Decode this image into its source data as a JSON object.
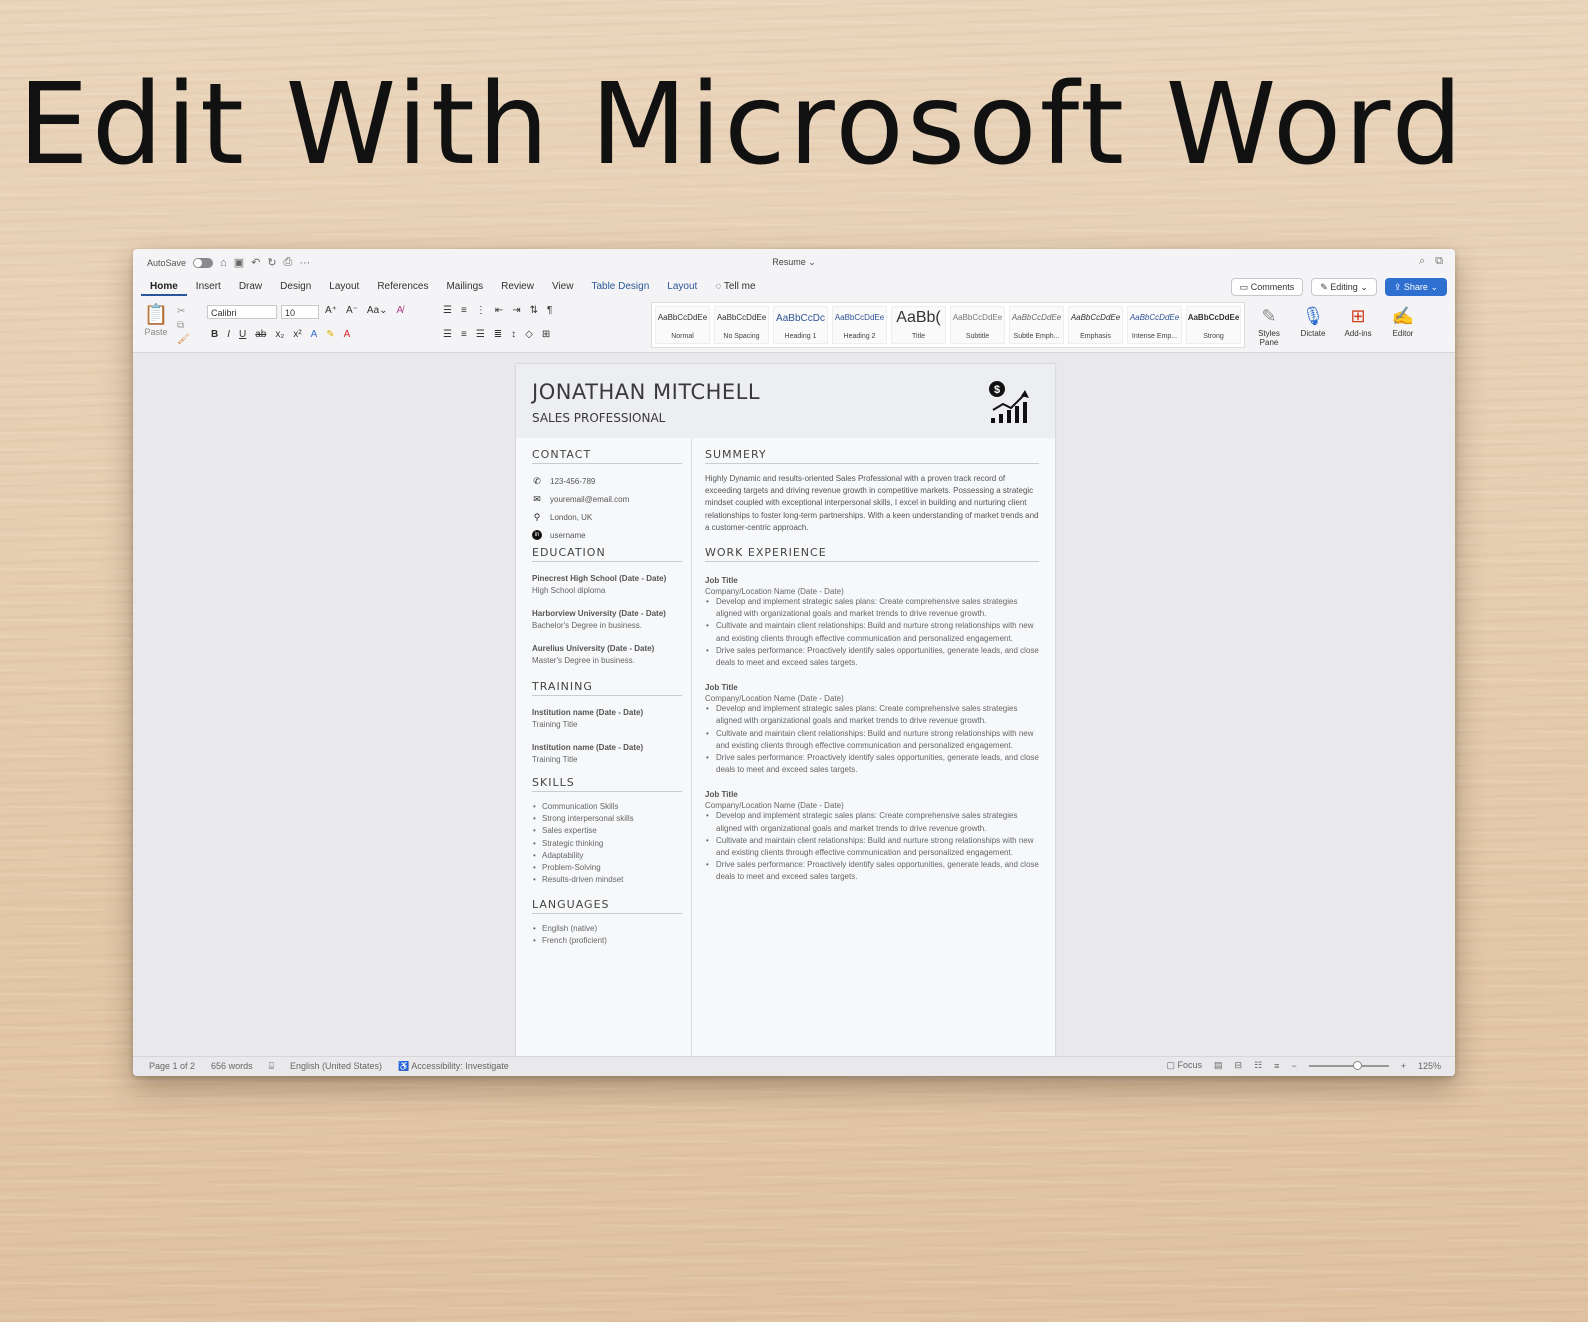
{
  "hero_title": "Edit With Microsoft Word",
  "titlebar": {
    "autosave": "AutoSave",
    "doc_title": "Resume"
  },
  "tabs": [
    "Home",
    "Insert",
    "Draw",
    "Design",
    "Layout",
    "References",
    "Mailings",
    "Review",
    "View",
    "Table Design",
    "Layout"
  ],
  "tell_me": "Tell me",
  "actions": {
    "comments": "Comments",
    "editing": "Editing",
    "share": "Share"
  },
  "ribbon": {
    "paste": "Paste",
    "font_name": "Calibri",
    "font_size": "10",
    "styles": [
      {
        "sample": "AaBbCcDdEe",
        "name": "Normal"
      },
      {
        "sample": "AaBbCcDdEe",
        "name": "No Spacing"
      },
      {
        "sample": "AaBbCcDc",
        "name": "Heading 1"
      },
      {
        "sample": "AaBbCcDdEe",
        "name": "Heading 2"
      },
      {
        "sample": "AaBb(",
        "name": "Title"
      },
      {
        "sample": "AaBbCcDdEe",
        "name": "Subtitle"
      },
      {
        "sample": "AaBbCcDdEe",
        "name": "Subtle Emph..."
      },
      {
        "sample": "AaBbCcDdEe",
        "name": "Emphasis"
      },
      {
        "sample": "AaBbCcDdEe",
        "name": "Intense Emp..."
      },
      {
        "sample": "AaBbCcDdEe",
        "name": "Strong"
      }
    ],
    "styles_pane": "Styles Pane",
    "dictate": "Dictate",
    "addins": "Add-ins",
    "editor": "Editor"
  },
  "resume": {
    "name": "JONATHAN MITCHELL",
    "role": "SALES PROFESSIONAL",
    "contact_title": "CONTACT",
    "contact": [
      {
        "icon": "phone-icon",
        "text": "123-456-789"
      },
      {
        "icon": "email-icon",
        "text": "youremail@email.com"
      },
      {
        "icon": "location-icon",
        "text": "London, UK"
      },
      {
        "icon": "linkedin-icon",
        "text": "username"
      }
    ],
    "education_title": "EDUCATION",
    "education": [
      {
        "school": "Pinecrest High School (Date - Date)",
        "degree": "High School diploma"
      },
      {
        "school": "Harborview University (Date - Date)",
        "degree": "Bachelor's Degree in business."
      },
      {
        "school": "Aurelius University (Date - Date)",
        "degree": "Master's Degree in business."
      }
    ],
    "training_title": "TRAINING",
    "training": [
      {
        "school": "Institution name (Date - Date)",
        "degree": "Training Title"
      },
      {
        "school": "Institution name (Date - Date)",
        "degree": "Training Title"
      }
    ],
    "skills_title": "SKILLS",
    "skills": [
      "Communication Skills",
      "Strong interpersonal skills",
      "Sales expertise",
      "Strategic thinking",
      "Adaptability",
      "Problem-Solving",
      "Results-driven mindset"
    ],
    "languages_title": "LANGUAGES",
    "languages": [
      "English (native)",
      "French (proficient)"
    ],
    "summary_title": "SUMMERY",
    "summary": "Highly Dynamic and results-oriented Sales Professional with a proven track record of exceeding targets and driving revenue growth in competitive markets. Possessing a strategic mindset coupled with exceptional interpersonal skills, I excel in building and nurturing client relationships to foster long-term partnerships. With a keen understanding of market trends and a customer-centric approach.",
    "work_title": "WORK EXPERIENCE",
    "jobs": [
      {
        "title": "Job Title",
        "company": "Company/Location Name (Date - Date)",
        "bullets": [
          "Develop and implement strategic sales plans: Create comprehensive sales strategies aligned with organizational goals and market trends to drive revenue growth.",
          "Cultivate and maintain client relationships: Build and nurture strong relationships with new and existing clients through effective communication and personalized engagement.",
          "Drive sales performance: Proactively identify sales opportunities, generate leads, and close deals to meet and exceed sales targets."
        ]
      },
      {
        "title": "Job Title",
        "company": "Company/Location Name (Date - Date)",
        "bullets": [
          "Develop and implement strategic sales plans: Create comprehensive sales strategies aligned with organizational goals and market trends to drive revenue growth.",
          "Cultivate and maintain client relationships: Build and nurture strong relationships with new and existing clients through effective communication and personalized engagement.",
          "Drive sales performance: Proactively identify sales opportunities, generate leads, and close deals to meet and exceed sales targets."
        ]
      },
      {
        "title": "Job Title",
        "company": "Company/Location Name (Date - Date)",
        "bullets": [
          "Develop and implement strategic sales plans: Create comprehensive sales strategies aligned with organizational goals and market trends to drive revenue growth.",
          "Cultivate and maintain client relationships: Build and nurture strong relationships with new and existing clients through effective communication and personalized engagement.",
          "Drive sales performance: Proactively identify sales opportunities, generate leads, and close deals to meet and exceed sales targets."
        ]
      }
    ]
  },
  "statusbar": {
    "page": "Page 1 of 2",
    "words": "656 words",
    "language": "English (United States)",
    "accessibility": "Accessibility: Investigate",
    "focus": "Focus",
    "zoom": "125%",
    "zoom_level_fraction": 0.6
  }
}
